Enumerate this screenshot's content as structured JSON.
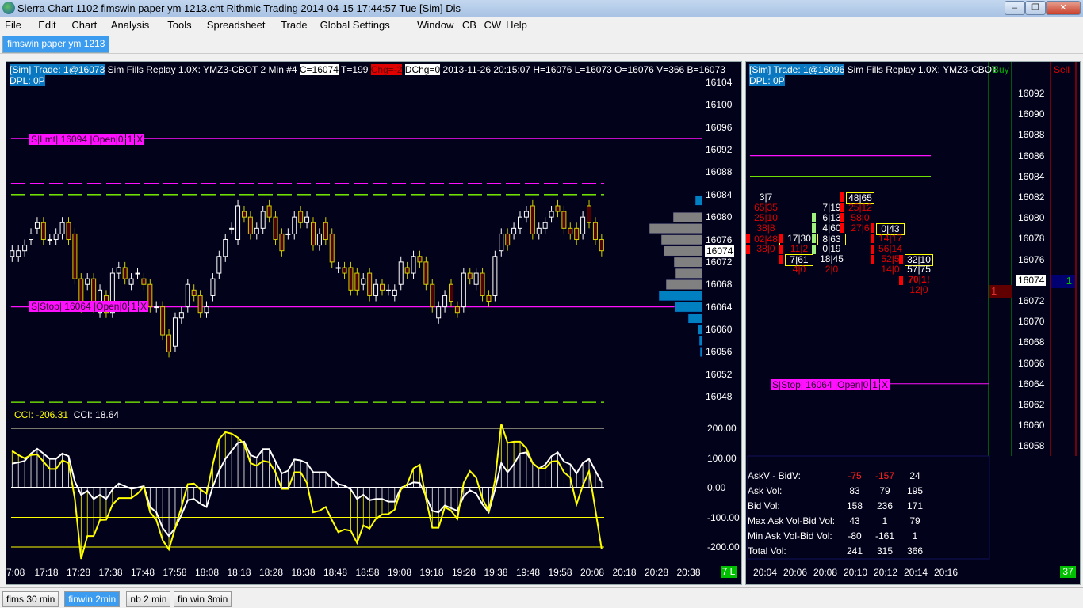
{
  "window": {
    "title": "Sierra Chart 1102 fimswin paper ym 1213.cht  Rithmic Trading 2014-04-15  17:44:57 Tue [Sim]  Dis",
    "min": "–",
    "max": "❐",
    "close": "✕"
  },
  "menu": [
    "File",
    "Edit",
    "Chart",
    "Analysis",
    "Tools",
    "Spreadsheet",
    "Trade",
    "Global Settings",
    "Window",
    "CB",
    "CW",
    "Help"
  ],
  "top_tab": "fimswin paper ym 1213",
  "left_chart": {
    "sim_trade": "[Sim]  Trade: 1@16073",
    "info1": " Sim Fills  Replay 1.0X: YMZ3-CBOT  2 Min   #4 ",
    "close": "C=16074",
    "trades": " T=199 ",
    "chg": "Chg=-2",
    "dchg": "DChg=0",
    "info2": " 2013-11-26 20:15:07 H=16076 L=16073 O=16076 V=366 B=16073",
    "dpl": "DPL: 0P",
    "price_labels": [
      "16104",
      "16100",
      "16096",
      "16092",
      "16088",
      "16084",
      "16080",
      "16076",
      "16072",
      "16068",
      "16064",
      "16060",
      "16056",
      "16052",
      "16048"
    ],
    "current_price": "16074",
    "lmt_order": {
      "side": "S",
      "type": "Lmt",
      "price": "16094",
      "status": "Open",
      "filled": "0",
      "qty": "1",
      "cancel": "X"
    },
    "stop_order": {
      "side": "S",
      "type": "Stop",
      "price": "16064",
      "status": "Open",
      "filled": "0",
      "qty": "1",
      "cancel": "X"
    },
    "cci_label_1": "CCI: -206.31",
    "cci_label_2": "CCI: 18.64",
    "cci_levels": [
      "200.00",
      "100.00",
      "0.00",
      "-100.00",
      "-200.00"
    ],
    "time_labels": [
      "7:08",
      "17:18",
      "17:28",
      "17:38",
      "17:48",
      "17:58",
      "18:08",
      "18:18",
      "18:28",
      "18:38",
      "18:48",
      "18:58",
      "19:08",
      "19:18",
      "19:28",
      "19:38",
      "19:48",
      "19:58",
      "20:08",
      "20:18",
      "20:28",
      "20:38"
    ],
    "status_box": "7 L",
    "colors": {
      "up": "#ffffff",
      "down_outline": "#d0d000",
      "down_fill": "#500000",
      "cci1": "#ffff00",
      "cci2": "#ffffff",
      "order": "#ff10ff"
    }
  },
  "chart_data": {
    "type": "candlestick",
    "price_range": [
      16046,
      16106
    ],
    "candles": [
      [
        16073,
        16074
      ],
      [
        16073,
        16074
      ],
      [
        16074,
        16075
      ],
      [
        16076,
        16077
      ],
      [
        16078,
        16079
      ],
      [
        16079,
        16076
      ],
      [
        16076,
        16076
      ],
      [
        16076,
        16077
      ],
      [
        16077,
        16079
      ],
      [
        16079,
        16076
      ],
      [
        16077,
        16069
      ],
      [
        16069,
        16064
      ],
      [
        16068,
        16069
      ],
      [
        16069,
        16064
      ],
      [
        16063,
        16067
      ],
      [
        16066,
        16063
      ],
      [
        16063,
        16070
      ],
      [
        16070,
        16071
      ],
      [
        16071,
        16069
      ],
      [
        16068,
        16069
      ],
      [
        16070,
        16070
      ],
      [
        16069,
        16068
      ],
      [
        16068,
        16064
      ],
      [
        16064,
        16064
      ],
      [
        16064,
        16059
      ],
      [
        16059,
        16056
      ],
      [
        16057,
        16062
      ],
      [
        16062,
        16063
      ],
      [
        16064,
        16068
      ],
      [
        16067,
        16066
      ],
      [
        16066,
        16063
      ],
      [
        16063,
        16064
      ],
      [
        16066,
        16069
      ],
      [
        16070,
        16073
      ],
      [
        16073,
        16076
      ],
      [
        16078,
        16078
      ],
      [
        16076,
        16082
      ],
      [
        16081,
        16080
      ],
      [
        16080,
        16077
      ],
      [
        16077,
        16078
      ],
      [
        16078,
        16081
      ],
      [
        16082,
        16080
      ],
      [
        16080,
        16076
      ],
      [
        16077,
        16074
      ],
      [
        16077,
        16077
      ],
      [
        16077,
        16080
      ],
      [
        16081,
        16079
      ],
      [
        16079,
        16080
      ],
      [
        16079,
        16075
      ],
      [
        16075,
        16077
      ],
      [
        16079,
        16076
      ],
      [
        16077,
        16072
      ],
      [
        16071,
        16071
      ],
      [
        16071,
        16070
      ],
      [
        16071,
        16067
      ],
      [
        16070,
        16067
      ],
      [
        16068,
        16069
      ],
      [
        16070,
        16066
      ],
      [
        16066,
        16068
      ],
      [
        16068,
        16067
      ],
      [
        16067,
        16067
      ],
      [
        16066,
        16067
      ],
      [
        16068,
        16072
      ],
      [
        16071,
        16070
      ],
      [
        16070,
        16073
      ],
      [
        16073,
        16072
      ],
      [
        16072,
        16068
      ],
      [
        16068,
        16064
      ],
      [
        16062,
        16064
      ],
      [
        16064,
        16066
      ],
      [
        16068,
        16065
      ],
      [
        16064,
        16063
      ],
      [
        16064,
        16070
      ],
      [
        16070,
        16069
      ],
      [
        16068,
        16070
      ],
      [
        16070,
        16066
      ],
      [
        16066,
        16065
      ],
      [
        16066,
        16073
      ],
      [
        16074,
        16077
      ],
      [
        16077,
        16075
      ],
      [
        16077,
        16078
      ],
      [
        16078,
        16080
      ],
      [
        16080,
        16081
      ],
      [
        16082,
        16077
      ],
      [
        16077,
        16078
      ],
      [
        16078,
        16079
      ],
      [
        16080,
        16081
      ],
      [
        16082,
        16081
      ],
      [
        16081,
        16078
      ],
      [
        16078,
        16077
      ],
      [
        16078,
        16076
      ],
      [
        16077,
        16080
      ],
      [
        16082,
        16079
      ],
      [
        16079,
        16076
      ],
      [
        16076,
        16074
      ]
    ],
    "volume_profile": [
      {
        "price": 16083,
        "vol": 9,
        "color": "#0080c0"
      },
      {
        "price": 16080,
        "vol": 37,
        "color": "#808080"
      },
      {
        "price": 16078,
        "vol": 67,
        "color": "#808080"
      },
      {
        "price": 16076,
        "vol": 52,
        "color": "#808080"
      },
      {
        "price": 16074,
        "vol": 49,
        "color": "#808080"
      },
      {
        "price": 16072,
        "vol": 36,
        "color": "#808080"
      },
      {
        "price": 16070,
        "vol": 34,
        "color": "#808080"
      },
      {
        "price": 16068,
        "vol": 46,
        "color": "#808080"
      },
      {
        "price": 16066,
        "vol": 55,
        "color": "#0080c0"
      },
      {
        "price": 16064,
        "vol": 35,
        "color": "#0080c0"
      },
      {
        "price": 16062,
        "vol": 18,
        "color": "#0080c0"
      },
      {
        "price": 16060,
        "vol": 6,
        "color": "#0080c0"
      },
      {
        "price": 16058,
        "vol": 4,
        "color": "#0080c0"
      },
      {
        "price": 16056,
        "vol": 3,
        "color": "#0080c0"
      }
    ],
    "reference_lines": [
      {
        "price": 16086,
        "color": "#ff10ff",
        "style": "dashed"
      },
      {
        "price": 16084,
        "color": "#80ff00",
        "style": "dashed"
      },
      {
        "price": 16047,
        "color": "#80ff00",
        "style": "dashed"
      },
      {
        "price": 16094,
        "color": "#ff10ff",
        "style": "solid"
      },
      {
        "price": 16064,
        "color": "#ff10ff",
        "style": "solid"
      }
    ],
    "cci_range": [
      -200,
      200
    ],
    "cci_yellow": [
      124,
      110,
      99,
      110,
      112,
      88,
      63,
      63,
      92,
      83,
      -38,
      -240,
      -163,
      -163,
      -109,
      -108,
      -57,
      -35,
      -35,
      -35,
      -20,
      3,
      -83,
      -109,
      -177,
      -208,
      -136,
      -65,
      12,
      14,
      -6,
      -20,
      79,
      164,
      187,
      182,
      169,
      146,
      83,
      74,
      90,
      86,
      52,
      -4,
      -4,
      52,
      52,
      16,
      -83,
      -78,
      -65,
      -109,
      -150,
      -141,
      -145,
      -186,
      -127,
      -138,
      -105,
      -90,
      -89,
      -74,
      -6,
      12,
      65,
      77,
      -38,
      -135,
      -135,
      -65,
      -78,
      -105,
      16,
      56,
      34,
      -38,
      -78,
      25,
      215,
      151,
      155,
      155,
      133,
      83,
      65,
      65,
      88,
      90,
      52,
      34,
      -56,
      7,
      56,
      -74,
      -206.31
    ],
    "cci_white": [
      81,
      85,
      90,
      115,
      131,
      115,
      97,
      97,
      115,
      106,
      21,
      -24,
      -11,
      -38,
      -24,
      -38,
      -6,
      14,
      5,
      -4,
      0,
      5,
      -65,
      -83,
      -136,
      -163,
      -136,
      -91,
      -42,
      -38,
      -54,
      -65,
      3,
      57,
      97,
      124,
      151,
      155,
      110,
      101,
      130,
      130,
      88,
      48,
      57,
      95,
      92,
      83,
      52,
      52,
      52,
      30,
      12,
      7,
      -6,
      -38,
      -24,
      -42,
      -38,
      -38,
      -47,
      -47,
      0,
      9,
      18,
      16,
      -29,
      -78,
      -83,
      -60,
      -69,
      -78,
      -29,
      -9,
      -20,
      -56,
      -83,
      -6,
      83,
      52,
      79,
      115,
      119,
      83,
      65,
      77,
      106,
      119,
      88,
      79,
      48,
      83,
      97,
      57,
      18.64
    ]
  },
  "right_chart": {
    "sim_trade": "[Sim]  Trade: 1@16096",
    "info": " Sim Fills  Replay 1.0X: YMZ3-CBOT",
    "dpl": "DPL: 0P",
    "buy_label": "Buy",
    "sell_label": "Sell",
    "price_labels": [
      "16092",
      "16090",
      "16088",
      "16086",
      "16084",
      "16082",
      "16080",
      "16078",
      "16076",
      "16074",
      "16072",
      "16070",
      "16068",
      "16066",
      "16064",
      "16062",
      "16060",
      "16058"
    ],
    "current_price": "16074",
    "buy_order_qty": "1",
    "sell_order_qty": "1",
    "stop_order": {
      "side": "S",
      "type": "Stop",
      "price": "16064",
      "status": "Open",
      "filled": "0",
      "qty": "1",
      "cancel": "X"
    },
    "footprint": [
      {
        "cells": [
          {
            "p": 16082,
            "t": "3|7",
            "c": "w"
          },
          {
            "p": 16081,
            "t": "65|35",
            "c": "r"
          },
          {
            "p": 16080,
            "t": "25|10",
            "c": "r"
          },
          {
            "p": 16079,
            "t": "38|8",
            "c": "r"
          },
          {
            "p": 16078,
            "t": "02|48",
            "c": "r",
            "box": 1,
            "bar": "r"
          },
          {
            "p": 16077,
            "t": "38|0",
            "c": "r",
            "bar": "r"
          }
        ]
      },
      {
        "cells": [
          {
            "p": 16078,
            "t": "17|30",
            "c": "w",
            "bar": "r"
          },
          {
            "p": 16077,
            "t": "11|2",
            "c": "r",
            "bar": "r"
          },
          {
            "p": 16076,
            "t": "7|61",
            "c": "w",
            "box": 1,
            "bar": "r"
          },
          {
            "p": 16075,
            "t": "4|0",
            "c": "r"
          }
        ]
      },
      {
        "cells": [
          {
            "p": 16081,
            "t": "7|19",
            "c": "w"
          },
          {
            "p": 16080,
            "t": "6|13",
            "c": "w",
            "bar": "g"
          },
          {
            "p": 16079,
            "t": "4|60",
            "c": "w",
            "bar": "g"
          },
          {
            "p": 16078,
            "t": "8|63",
            "c": "w",
            "box": 1,
            "bar": "g"
          },
          {
            "p": 16077,
            "t": "0|19",
            "c": "w",
            "bar": "g"
          },
          {
            "p": 16076,
            "t": "18|45",
            "c": "w"
          },
          {
            "p": 16075,
            "t": "2|0",
            "c": "r"
          }
        ]
      },
      {
        "cells": [
          {
            "p": 16082,
            "t": "48|65",
            "c": "w",
            "box": 1,
            "bar": "r"
          },
          {
            "p": 16081,
            "t": "25|12",
            "c": "r",
            "bar": "r"
          },
          {
            "p": 16080,
            "t": "58|0",
            "c": "r",
            "bar": "r"
          },
          {
            "p": 16079,
            "t": "27|6",
            "c": "r",
            "bar": "r"
          }
        ]
      },
      {
        "cells": [
          {
            "p": 16079,
            "t": "0|43",
            "c": "w",
            "box": 1,
            "bar": "r"
          },
          {
            "p": 16078,
            "t": "14|17",
            "c": "r",
            "bar": "r"
          },
          {
            "p": 16077,
            "t": "56|14",
            "c": "r",
            "bar": "r"
          },
          {
            "p": 16076,
            "t": "52|5",
            "c": "r",
            "bar": "r"
          },
          {
            "p": 16075,
            "t": "14|0",
            "c": "r"
          }
        ]
      },
      {
        "cells": [
          {
            "p": 16076,
            "t": "32|10",
            "c": "w",
            "box": 1,
            "bar": "r"
          },
          {
            "p": 16075,
            "t": "57|75",
            "c": "w"
          },
          {
            "p": 16074,
            "t": "70|1!",
            "c": "r",
            "bold": 1,
            "bar": "r"
          },
          {
            "p": 16073,
            "t": "12|0",
            "c": "r"
          }
        ]
      }
    ],
    "stats": [
      {
        "label": "AskV - BidV:",
        "values": [
          "-75",
          "-157",
          "24"
        ],
        "neg": [
          true,
          true,
          false
        ]
      },
      {
        "label": "Ask Vol:",
        "values": [
          "83",
          "79",
          "195"
        ]
      },
      {
        "label": "Bid Vol:",
        "values": [
          "158",
          "236",
          "171"
        ]
      },
      {
        "label": "Max Ask Vol-Bid Vol:",
        "values": [
          "43",
          "1",
          "79"
        ]
      },
      {
        "label": "Min Ask Vol-Bid Vol:",
        "values": [
          "-80",
          "-161",
          "1"
        ]
      },
      {
        "label": "Total Vol:",
        "values": [
          "241",
          "315",
          "366"
        ]
      }
    ],
    "time_labels": [
      "20:04",
      "20:06",
      "20:08",
      "20:10",
      "20:12",
      "20:14",
      "20:16"
    ],
    "status_box": "37"
  },
  "bottom_tabs": [
    {
      "label": "fims 30 min"
    },
    {
      "label": "finwin 2min",
      "selected": true
    },
    {
      "label": "nb 2 min"
    },
    {
      "label": "fin win 3min"
    }
  ]
}
